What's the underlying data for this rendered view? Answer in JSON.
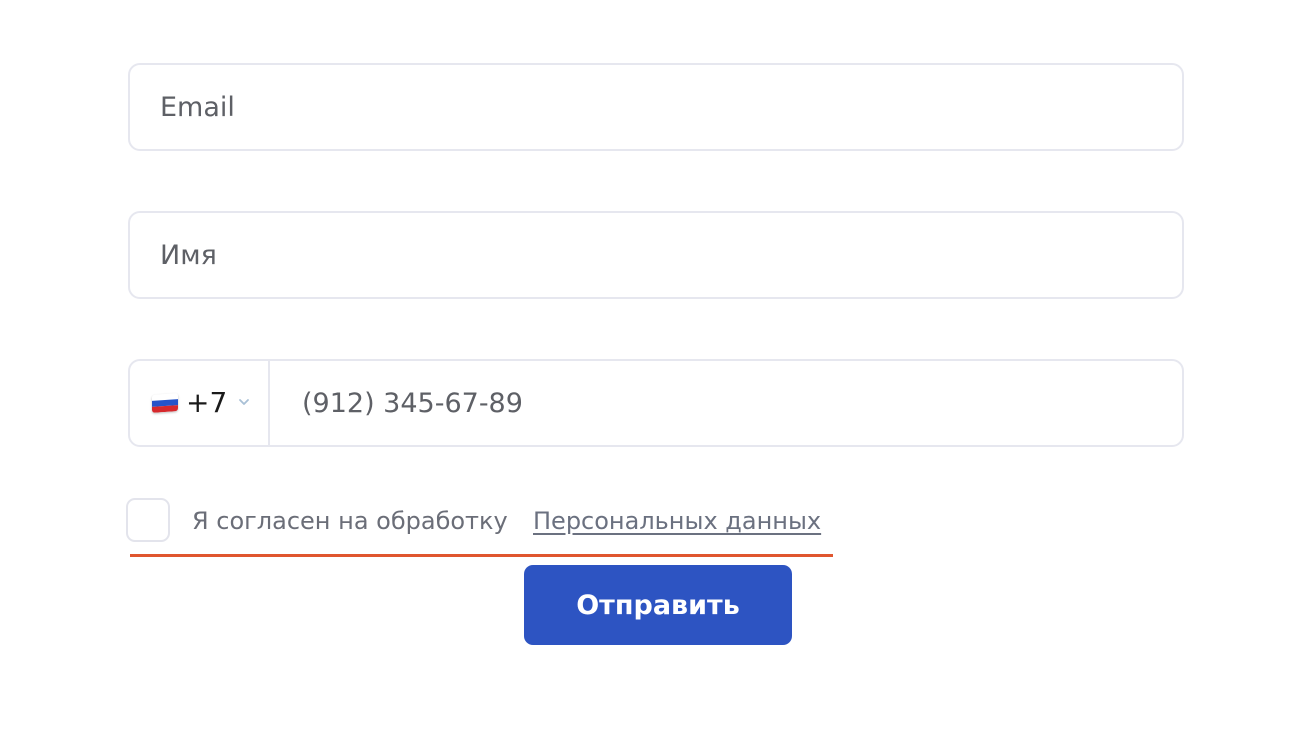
{
  "form": {
    "email": {
      "placeholder": "Email",
      "value": ""
    },
    "name": {
      "placeholder": "Имя",
      "value": ""
    },
    "phone": {
      "country_icon": "russia-flag-icon",
      "dial_code": "+7",
      "placeholder": "(912) 345-67-89",
      "value": ""
    },
    "consent": {
      "checked": false,
      "text": "Я согласен на обработку",
      "link_text": "Персональных данных",
      "error_color": "#e0562f"
    },
    "submit_label": "Отправить"
  },
  "colors": {
    "accent": "#2d54c2",
    "border": "#e6e7ef",
    "error": "#e0562f"
  }
}
